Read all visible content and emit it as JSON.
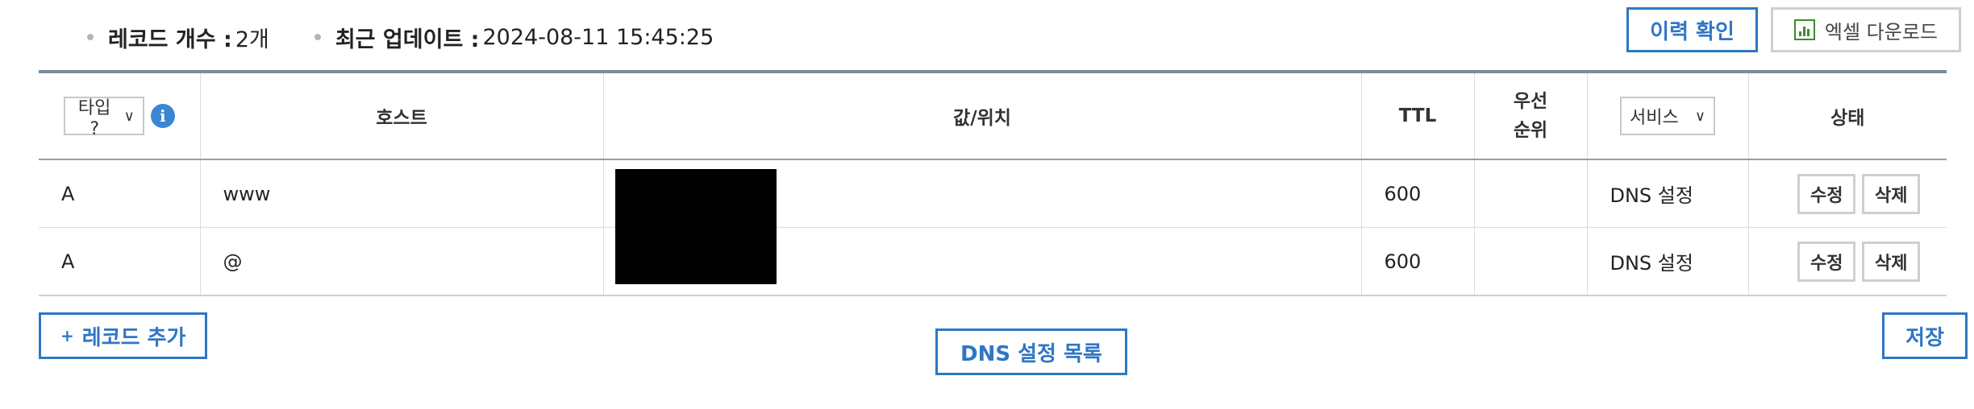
{
  "summary": {
    "record_count_label": "레코드 개수 :",
    "record_count_value": "2개",
    "last_update_label": "최근 업데이트 :",
    "last_update_value": "2024-08-11 15:45:25"
  },
  "top_buttons": {
    "history": "이력 확인",
    "excel_download": "엑셀 다운로드"
  },
  "table": {
    "type_select": "타입 ?",
    "host": "호스트",
    "value": "값/위치",
    "ttl": "TTL",
    "priority_line1": "우선",
    "priority_line2": "순위",
    "service_select": "서비스",
    "status": "상태",
    "rows": [
      {
        "type": "A",
        "host": "www",
        "ttl": "600",
        "priority": "",
        "service": "DNS 설정",
        "edit": "수정",
        "delete": "삭제"
      },
      {
        "type": "A",
        "host": "@",
        "ttl": "600",
        "priority": "",
        "service": "DNS 설정",
        "edit": "수정",
        "delete": "삭제"
      }
    ]
  },
  "bottom": {
    "add_record": "레코드 추가",
    "add_record_prefix": "+",
    "dns_list": "DNS 설정 목록",
    "save": "저장"
  },
  "colors": {
    "accent": "#2f76c5",
    "info_icon": "#3a86d3",
    "excel_green": "#3c8c2f",
    "redaction": "#000000"
  }
}
